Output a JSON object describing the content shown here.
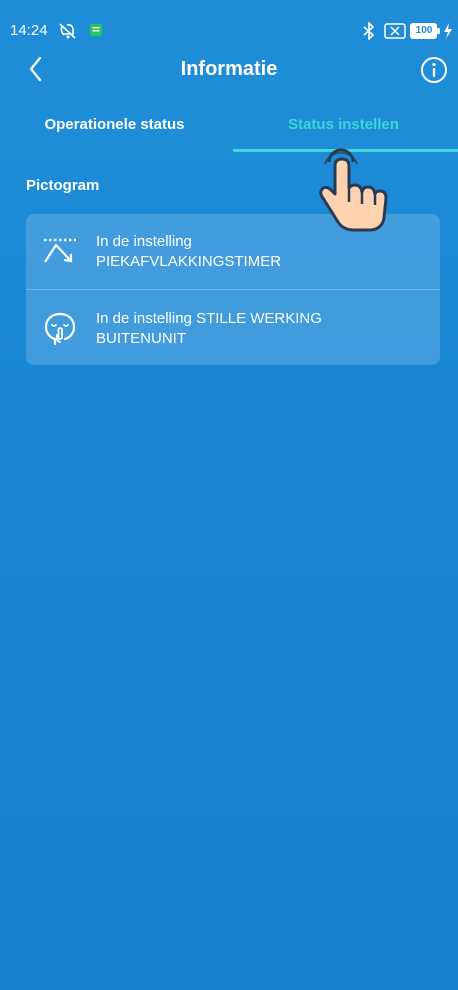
{
  "status_bar": {
    "time": "14:24",
    "battery": "100",
    "icons": [
      "mute-icon",
      "message-icon",
      "bluetooth-icon",
      "no-sim-icon",
      "battery-icon",
      "charging-bolt-icon"
    ]
  },
  "header": {
    "title": "Informatie",
    "back_icon": "chevron-left-icon",
    "info_icon": "info-icon"
  },
  "tabs": [
    {
      "label": "Operationele status",
      "selected": false
    },
    {
      "label": "Status instellen",
      "selected": true
    }
  ],
  "section": {
    "label": "Pictogram"
  },
  "items": [
    {
      "icon": "peak-shaving-timer-icon",
      "line1": "In de instelling",
      "line2": "PIEKAFVLAKKINGSTIMER"
    },
    {
      "icon": "silent-mode-icon",
      "line1": "In de instelling STILLE WERKING",
      "line2": "BUITENUNIT"
    }
  ],
  "colors": {
    "background": "#1a86d4",
    "header": "#1e8cd6",
    "accent": "#3ad7d6",
    "text": "#ffffff"
  },
  "overlay": {
    "icon": "tap-hand-icon"
  }
}
